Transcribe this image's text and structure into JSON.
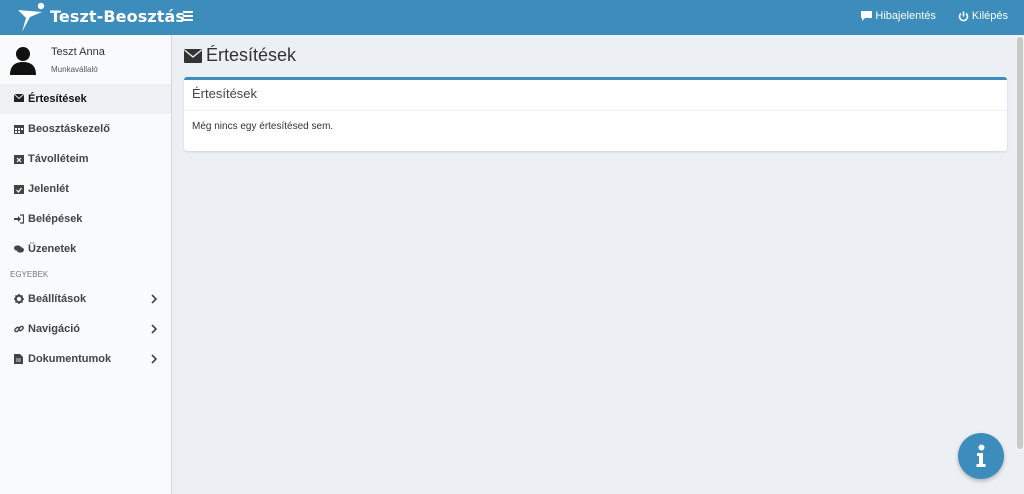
{
  "header": {
    "brand": "Teszt-Beosztás",
    "report_label": "Hibajelentés",
    "logout_label": "Kilépés",
    "accent_color": "#3c8dbc"
  },
  "user": {
    "name": "Teszt Anna",
    "role": "Munkavállaló"
  },
  "sidebar": {
    "items": [
      {
        "label": "Értesítések",
        "icon": "envelope-icon",
        "active": true
      },
      {
        "label": "Beosztáskezelő",
        "icon": "calendar-icon"
      },
      {
        "label": "Távolléteim",
        "icon": "calendar-x-icon"
      },
      {
        "label": "Jelenlét",
        "icon": "calendar-check-icon"
      },
      {
        "label": "Belépések",
        "icon": "sign-in-icon"
      },
      {
        "label": "Üzenetek",
        "icon": "comments-icon"
      }
    ],
    "section_label": "EGYEBEK",
    "other_items": [
      {
        "label": "Beállítások",
        "icon": "gear-icon"
      },
      {
        "label": "Navigáció",
        "icon": "link-icon"
      },
      {
        "label": "Dokumentumok",
        "icon": "file-icon"
      }
    ]
  },
  "main": {
    "page_title": "Értesítések",
    "box_title": "Értesítések",
    "empty_message": "Még nincs egy értesítésed sem."
  }
}
